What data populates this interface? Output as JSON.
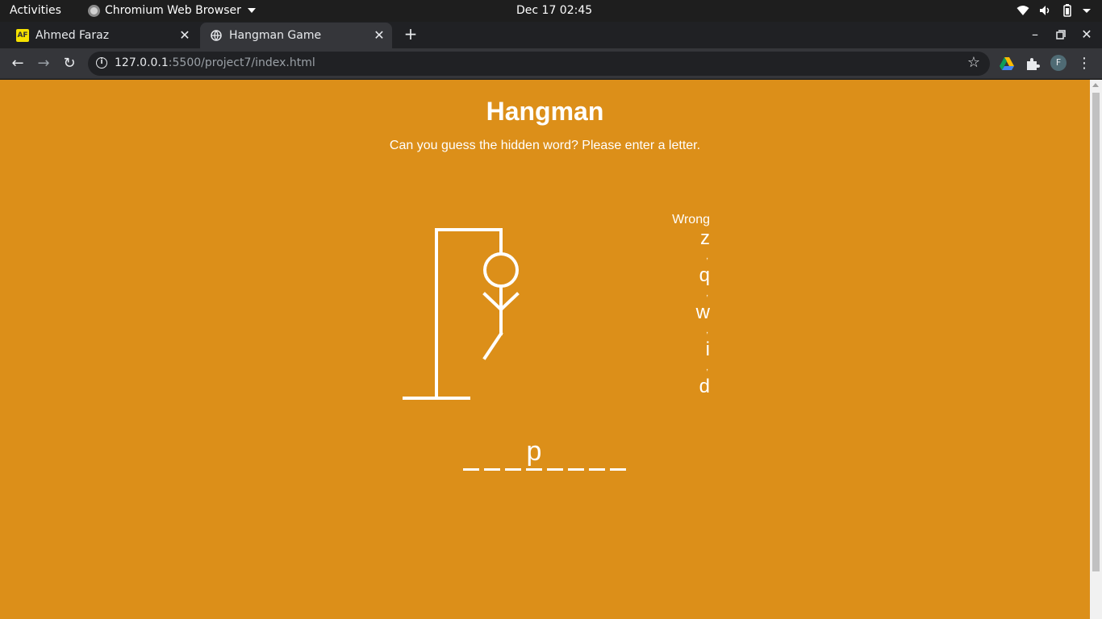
{
  "topbar": {
    "activities": "Activities",
    "app_name": "Chromium Web Browser",
    "clock": "Dec 17  02:45"
  },
  "tabs": [
    {
      "title": "Ahmed Faraz",
      "favicon": "AF",
      "active": false
    },
    {
      "title": "Hangman Game",
      "favicon": "globe-icon",
      "active": true
    }
  ],
  "toolbar": {
    "url_host": "127.0.0.1",
    "url_rest": ":5500/project7/index.html",
    "profile_initial": "F"
  },
  "page": {
    "title": "Hangman",
    "subtitle": "Can you guess the hidden word? Please enter a letter.",
    "wrong_label": "Wrong",
    "wrong_letters": [
      "z",
      "q",
      "w",
      "i",
      "d"
    ],
    "word_slots": [
      "",
      "",
      "",
      "p",
      "",
      "",
      "",
      ""
    ]
  },
  "colors": {
    "page_background": "#dc8f19",
    "text": "#ffffff"
  }
}
